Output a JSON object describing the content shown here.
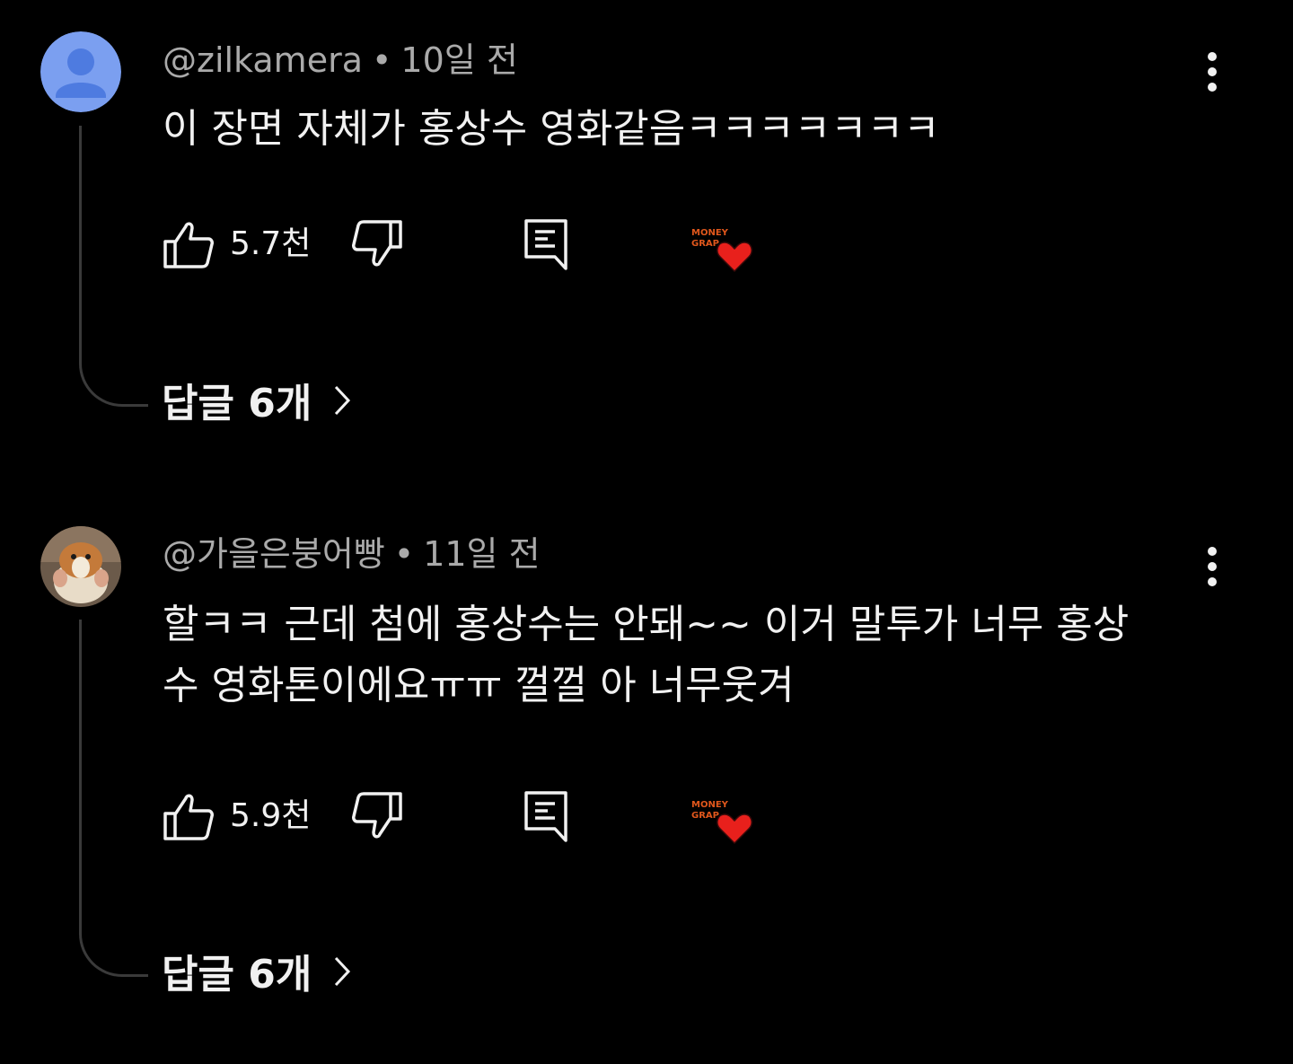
{
  "comments": [
    {
      "author": "@zilkamera",
      "separator": "•",
      "time": "10일 전",
      "text": "이 장면 자체가 홍상수 영화같음ㅋㅋㅋㅋㅋㅋㅋ",
      "likes": "5.7천",
      "creator_badge_text": "MONEY GRAP",
      "replies_label": "답글 6개"
    },
    {
      "author": "@가을은붕어빵",
      "separator": "•",
      "time": "11일 전",
      "text": "할ㅋㅋ 근데 첨에 홍상수는 안돼~~ 이거 말투가 너무 홍상수 영화톤이에요ㅠㅠ 껄껄 아 너무웃겨",
      "likes": "5.9천",
      "creator_badge_text": "MONEY GRAP",
      "replies_label": "답글 6개"
    }
  ],
  "icons": {
    "like": "thumb-up-icon",
    "dislike": "thumb-down-icon",
    "reply": "comment-reply-icon",
    "more": "more-vertical-icon",
    "expand": "chevron-right-icon",
    "creator_heart": "creator-heart-icon"
  },
  "colors": {
    "background": "#000000",
    "text_primary": "#f1f1f1",
    "text_secondary": "#aaaaaa",
    "default_avatar": "#7b9ff0",
    "heart": "#e8201c"
  }
}
